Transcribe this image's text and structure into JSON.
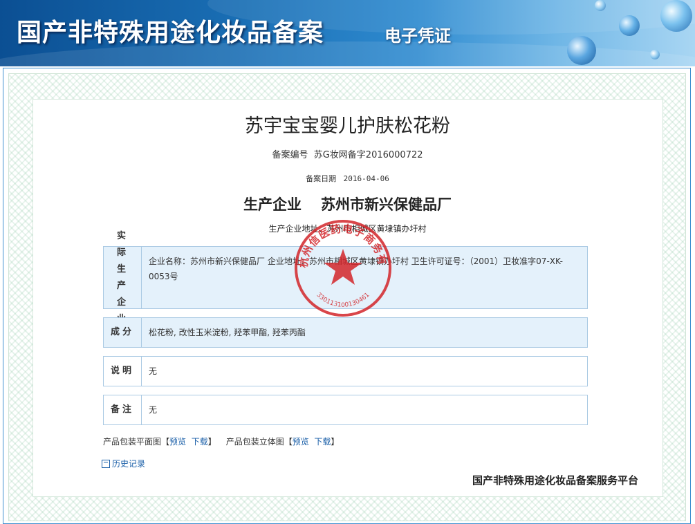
{
  "banner": {
    "title": "国产非特殊用途化妆品备案",
    "subtitle": "电子凭证"
  },
  "product": {
    "name": "苏宇宝宝婴儿护肤松花粉",
    "record_no_label": "备案编号",
    "record_no": "苏G妆网备字2016000722",
    "record_date_label": "备案日期",
    "record_date": "2016-04-06",
    "producer_label": "生产企业",
    "producer": "苏州市新兴保健品厂",
    "producer_addr_label": "生产企业地址",
    "producer_addr": "苏州市相城区黄埭镇办圩村"
  },
  "sections": {
    "actual": {
      "label": "实际生产企业",
      "content": "企业名称：苏州市新兴保健品厂    企业地址：苏州市相城区黄埭镇办圩村    卫生许可证号：（2001）卫妆准字07-XK-0053号"
    },
    "ingredients": {
      "label": "成分",
      "content": "松花粉, 改性玉米淀粉, 羟苯甲酯, 羟苯丙酯"
    },
    "notes": {
      "label": "说明",
      "content": "无"
    },
    "remarks": {
      "label": "备注",
      "content": "无"
    }
  },
  "links": {
    "flat_label": "产品包装平面图",
    "stereo_label": "产品包装立体图",
    "preview": "预览",
    "download": "下载",
    "history": "历史记录"
  },
  "stamp": {
    "text": "杭州信医药电子商务有限公司",
    "code": "330113100130461"
  },
  "footer": {
    "platform": "国产非特殊用途化妆品备案服务平台"
  },
  "colors": {
    "banner_dark": "#0b4f93",
    "link": "#1a5fa8",
    "stamp_red": "#d3262b",
    "section_bg": "#e4f1fb"
  }
}
